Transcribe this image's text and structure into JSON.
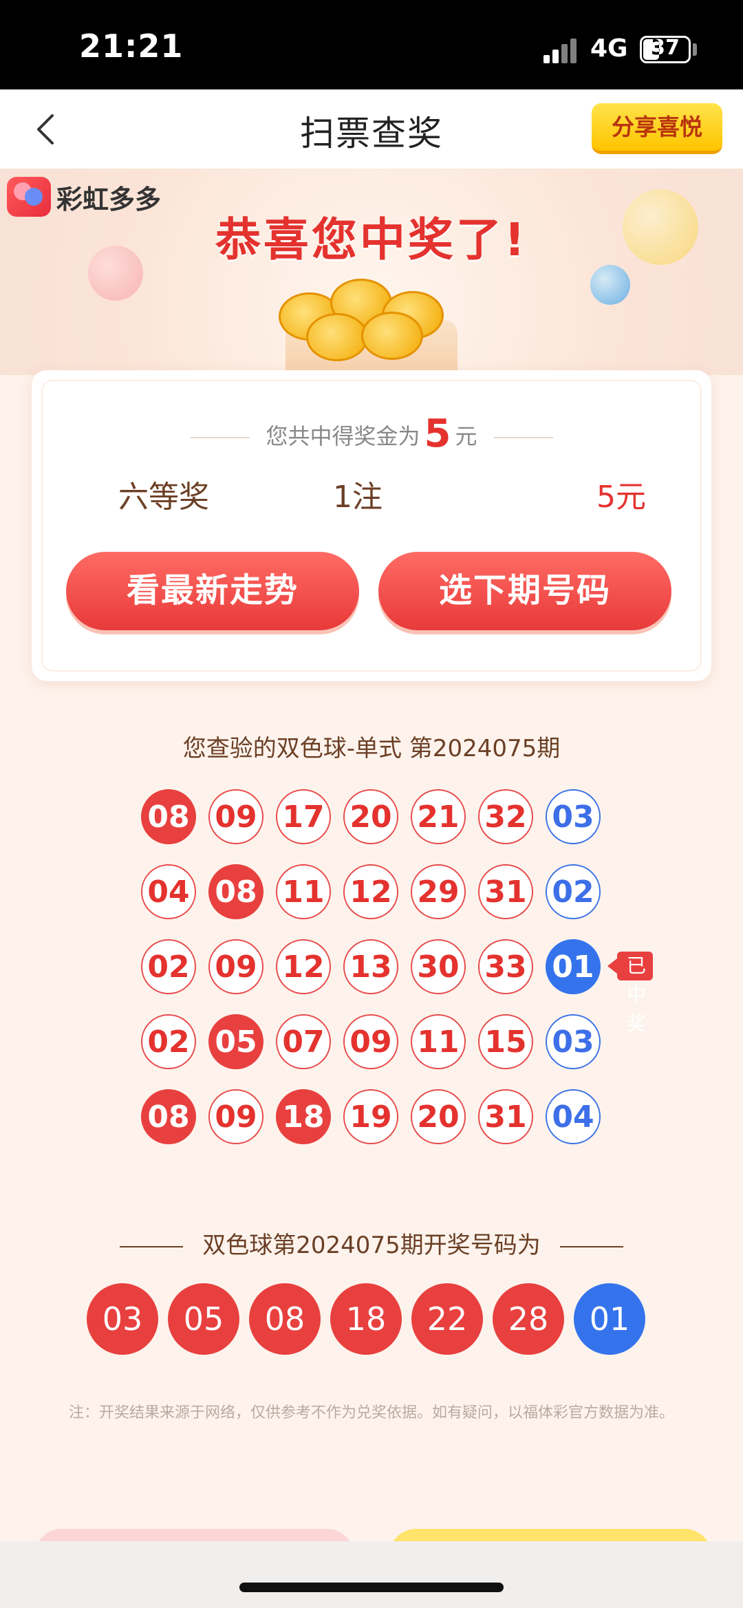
{
  "status_bar": {
    "time": "21:21",
    "network": "4G",
    "battery": "37"
  },
  "nav": {
    "title": "扫票查奖",
    "share_label": "分享喜悦"
  },
  "hero": {
    "brand": "彩虹多多",
    "headline": "恭喜您中奖了!"
  },
  "prize_card": {
    "total_prefix": "您共中得奖金为",
    "total_amount": "5",
    "total_unit": "元",
    "row": {
      "level": "六等奖",
      "count": "1注",
      "money": "5元"
    },
    "btn_trend": "看最新走势",
    "btn_next": "选下期号码"
  },
  "ticket": {
    "title": "您查验的双色球-单式 第2024075期",
    "won_tag": "已中奖",
    "rows": [
      {
        "reds": [
          "08",
          "09",
          "17",
          "20",
          "21",
          "32"
        ],
        "red_hits": [
          true,
          false,
          false,
          false,
          false,
          false
        ],
        "blue": "03",
        "blue_hit": false
      },
      {
        "reds": [
          "04",
          "08",
          "11",
          "12",
          "29",
          "31"
        ],
        "red_hits": [
          false,
          true,
          false,
          false,
          false,
          false
        ],
        "blue": "02",
        "blue_hit": false
      },
      {
        "reds": [
          "02",
          "09",
          "12",
          "13",
          "30",
          "33"
        ],
        "red_hits": [
          false,
          false,
          false,
          false,
          false,
          false
        ],
        "blue": "01",
        "blue_hit": true
      },
      {
        "reds": [
          "02",
          "05",
          "07",
          "09",
          "11",
          "15"
        ],
        "red_hits": [
          false,
          true,
          false,
          false,
          false,
          false
        ],
        "blue": "03",
        "blue_hit": false
      },
      {
        "reds": [
          "08",
          "09",
          "18",
          "19",
          "20",
          "31"
        ],
        "red_hits": [
          true,
          false,
          true,
          false,
          false,
          false
        ],
        "blue": "04",
        "blue_hit": false
      }
    ]
  },
  "draw": {
    "title": "双色球第2024075期开奖号码为",
    "reds": [
      "03",
      "05",
      "08",
      "18",
      "22",
      "28"
    ],
    "blue": "01"
  },
  "note": "注：开奖结果来源于网络，仅供参考不作为兑奖依据。如有疑问，以福体彩官方数据为准。",
  "colors": {
    "red": "#e8403f",
    "blue": "#3473ec",
    "gold": "#ffc400",
    "text_brown": "#6b3f25"
  }
}
